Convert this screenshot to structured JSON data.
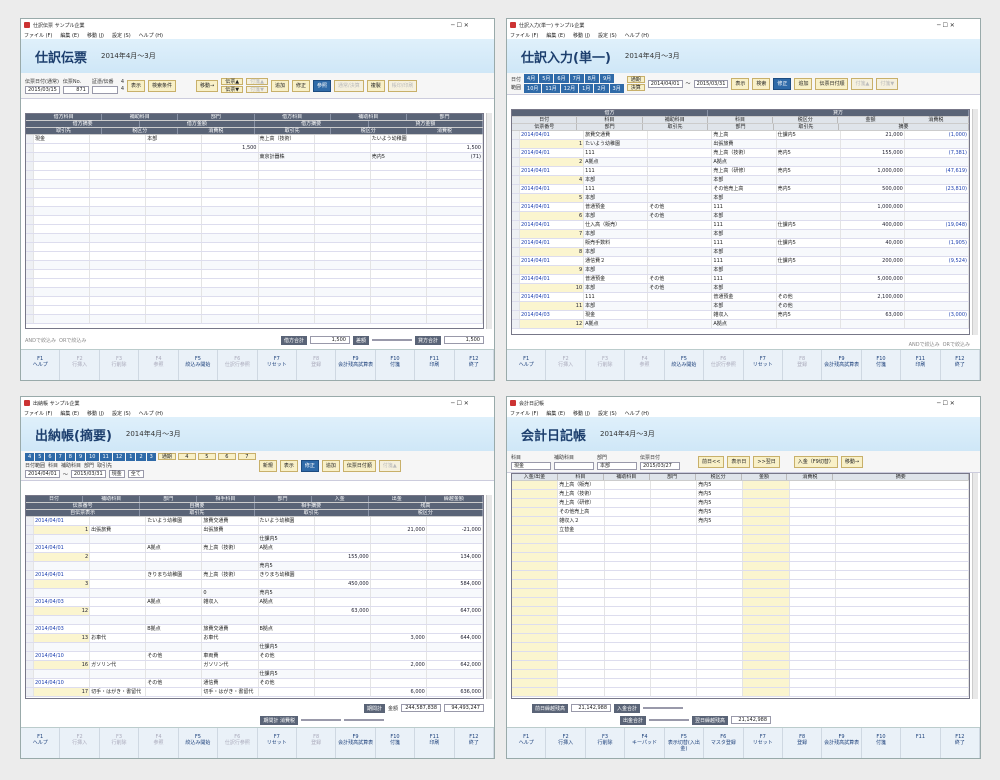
{
  "w1": {
    "title": "仕訳伝票 サンプル企業",
    "menu": [
      "ファイル (F)",
      "編集 (E)",
      "移動 (J)",
      "設定 (S)",
      "ヘルプ (H)"
    ],
    "heading": "仕訳伝票",
    "period": "2014年4月～3月",
    "labels": {
      "date": "伝票日付(通常)",
      "no": "伝票No.",
      "proof": "証憑/伝番",
      "disp": "表示",
      "cond": "検索条件",
      "move": "移動→",
      "slip_up": "伝票▲",
      "slip_dn": "伝票▼",
      "line_up": "付箋▲",
      "line_dn": "付箋▼",
      "add": "追加",
      "fix": "修正",
      "ref": "参照",
      "normal": "通常/決算",
      "copy": "複製",
      "print": "帳印/印刷"
    },
    "date_val": "2015/03/15",
    "no_val": "871",
    "cnt": "4",
    "cnt2": "4",
    "head1": [
      "借方科目",
      "補助科目",
      "部門",
      "借方科目",
      "補助科目",
      "部門"
    ],
    "head2": [
      "借方摘要",
      "借方金額",
      "借方摘要",
      "貸方金額"
    ],
    "head3": [
      "取引先",
      "税区分",
      "消費税",
      "取引先",
      "税区分",
      "消費税"
    ],
    "rows": [
      [
        "現金",
        "",
        "本部",
        "",
        "売上高（技術）",
        "",
        "たいよう幼稚園",
        ""
      ],
      [
        "",
        "",
        "",
        "1,500",
        "",
        "",
        "",
        "1,500"
      ],
      [
        "",
        "",
        "",
        "",
        "東京計器株",
        "",
        "売内5",
        "(71)"
      ]
    ],
    "sum": {
      "and": "ANDで絞込み",
      "or": "ORで絞込み",
      "dr": "借方合計",
      "dr_val": "1,500",
      "diff": "差額",
      "cr": "貸方合計",
      "cr_val": "1,500"
    },
    "fkeys": [
      [
        "F1",
        "ヘルプ"
      ],
      [
        "F2",
        "行挿入"
      ],
      [
        "F3",
        "行削除"
      ],
      [
        "F4",
        "参照"
      ],
      [
        "F5",
        "絞込み開始"
      ],
      [
        "F6",
        "仕訳行参照"
      ],
      [
        "F7",
        "リセット"
      ],
      [
        "F8",
        "登録"
      ],
      [
        "F9",
        "会計残高試算表"
      ],
      [
        "F10",
        "付箋"
      ],
      [
        "F11",
        "印刷"
      ],
      [
        "F12",
        "終了"
      ]
    ]
  },
  "w2": {
    "title": "仕訳入力(単一) サンプル企業",
    "heading": "仕訳入力(単一)",
    "period": "2014年4月～3月",
    "months": [
      "4月",
      "5月",
      "6月",
      "7月",
      "8月",
      "9月",
      "10月",
      "11月",
      "12月",
      "1月",
      "2月",
      "3月"
    ],
    "m_extra": [
      "通期",
      "決算"
    ],
    "range_lbl": "日付",
    "range_lbl2": "範囲",
    "from": "2014/04/01",
    "to": "2015/03/31",
    "btns": [
      "表示",
      "検索",
      "修正",
      "追加",
      "伝票日付順"
    ],
    "tag_up": "付箋▲",
    "tag_dn": "付箋▼",
    "headA": [
      "借方",
      "",
      "",
      "貸方",
      "",
      ""
    ],
    "headB": [
      "日付",
      "科目",
      "補助科目",
      "科目",
      "税区分",
      "金額",
      "消費税"
    ],
    "headC": [
      "伝票番号",
      "証憑/伝番",
      "部門",
      "取引先",
      "部門",
      "取引先",
      "摘要"
    ],
    "rows": [
      [
        "2014/04/01",
        "旅費交通費",
        "",
        "売上高",
        "仕課内5",
        "21,000",
        "(1,000)"
      ],
      [
        "1",
        "たいよう幼稚園",
        "",
        "出張旅費",
        "",
        "",
        ""
      ],
      [
        "2014/04/01",
        "111",
        "",
        "売上高（技術）",
        "売内5",
        "155,000",
        "(7,381)"
      ],
      [
        "2",
        "A拠点",
        "",
        "A拠点",
        "",
        "",
        ""
      ],
      [
        "2014/04/01",
        "111",
        "",
        "売上高（研修）",
        "売内5",
        "1,000,000",
        "(47,619)"
      ],
      [
        "4",
        "本部",
        "",
        "本部",
        "",
        "",
        ""
      ],
      [
        "2014/04/01",
        "111",
        "",
        "その他売上高",
        "売内5",
        "500,000",
        "(23,810)"
      ],
      [
        "5",
        "本部",
        "",
        "本部",
        "",
        "",
        ""
      ],
      [
        "2014/04/01",
        "普通預金",
        "その他",
        "111",
        "",
        "1,000,000",
        ""
      ],
      [
        "6",
        "本部",
        "その他",
        "本部",
        "",
        "",
        ""
      ],
      [
        "2014/04/01",
        "仕入高（販売）",
        "",
        "111",
        "仕課内5",
        "400,000",
        "(19,048)"
      ],
      [
        "7",
        "本部",
        "",
        "本部",
        "",
        "",
        ""
      ],
      [
        "2014/04/01",
        "販売手数料",
        "",
        "111",
        "仕課内5",
        "40,000",
        "(1,905)"
      ],
      [
        "8",
        "本部",
        "",
        "本部",
        "",
        "",
        ""
      ],
      [
        "2014/04/01",
        "通信費２",
        "",
        "111",
        "仕課内5",
        "200,000",
        "(9,524)"
      ],
      [
        "9",
        "本部",
        "",
        "本部",
        "",
        "",
        ""
      ],
      [
        "2014/04/01",
        "普通預金",
        "その他",
        "111",
        "",
        "5,000,000",
        ""
      ],
      [
        "10",
        "本部",
        "その他",
        "本部",
        "",
        "",
        ""
      ],
      [
        "2014/04/01",
        "111",
        "",
        "普通預金",
        "その他",
        "2,100,000",
        ""
      ],
      [
        "11",
        "本部",
        "",
        "本部",
        "その他",
        "",
        ""
      ],
      [
        "2014/04/03",
        "現金",
        "",
        "雑収入",
        "売内5",
        "63,000",
        "(3,000)"
      ],
      [
        "12",
        "A拠点",
        "",
        "A拠点",
        "",
        "",
        ""
      ]
    ],
    "and": "ANDで絞込み",
    "or": "ORで絞込み",
    "fkeys": [
      [
        "F1",
        "ヘルプ"
      ],
      [
        "F2",
        "行挿入"
      ],
      [
        "F3",
        "行削除"
      ],
      [
        "F4",
        "参照"
      ],
      [
        "F5",
        "絞込み開始"
      ],
      [
        "F6",
        "仕訳行参照"
      ],
      [
        "F7",
        "リセット"
      ],
      [
        "F8",
        "登録"
      ],
      [
        "F9",
        "会計残高試算表"
      ],
      [
        "F10",
        "付箋"
      ],
      [
        "F11",
        "印刷"
      ],
      [
        "F12",
        "終了"
      ]
    ]
  },
  "w3": {
    "title": "出納帳 サンプル企業",
    "heading": "出納帳(摘要)",
    "period": "2014年4月～3月",
    "months": [
      "4",
      "5",
      "6",
      "7",
      "8",
      "9",
      "10",
      "11",
      "12",
      "1",
      "2",
      "3"
    ],
    "m_extra": [
      "通期",
      "4",
      "5",
      "6",
      "7"
    ],
    "range": "日付範囲",
    "from": "2014/04/01",
    "to": "2015/03/31",
    "acct": "現金",
    "sub_lbl": "科目",
    "sub2": "補助科目",
    "dept": "部門",
    "all": "全て",
    "partner": "取引先",
    "btns": [
      "新規",
      "表示",
      "修正",
      "追加",
      "伝票日付順"
    ],
    "tag_up": "付箋▲",
    "tag_dn": "付箋▼",
    "headA": [
      "日付",
      "補助科目",
      "部門",
      "相手科目",
      "部門",
      "入金",
      "出金",
      "繰越金額"
    ],
    "headB": [
      "伝票番号",
      "自摘要",
      "相手摘要",
      "残高"
    ],
    "headC": [
      "自伝票表示",
      "取引先",
      "取引先",
      "税区分"
    ],
    "rows": [
      [
        "2014/04/01",
        "",
        "たいよう幼稚園",
        "旅費交通費",
        "たいよう幼稚園",
        "",
        "",
        ""
      ],
      [
        "1",
        "出張旅費",
        "",
        "出張旅費",
        "",
        "",
        "21,000",
        "-21,000"
      ],
      [
        "",
        "",
        "",
        "",
        "仕課内5",
        "",
        "",
        ""
      ],
      [
        "2014/04/01",
        "",
        "A拠点",
        "売上高（技術）",
        "A拠点",
        "",
        "",
        ""
      ],
      [
        "2",
        "",
        "",
        "",
        "",
        "155,000",
        "",
        "134,000"
      ],
      [
        "",
        "",
        "",
        "",
        "売内5",
        "",
        "",
        ""
      ],
      [
        "2014/04/01",
        "",
        "きりまち幼稚園",
        "売上高（技術）",
        "きりまち幼稚園",
        "",
        "",
        ""
      ],
      [
        "3",
        "",
        "",
        "",
        "",
        "450,000",
        "",
        "584,000"
      ],
      [
        "",
        "",
        "",
        "0",
        "売内5",
        "",
        "",
        ""
      ],
      [
        "2014/04/03",
        "",
        "A拠点",
        "雑収入",
        "A拠点",
        "",
        "",
        ""
      ],
      [
        "12",
        "",
        "",
        "",
        "",
        "63,000",
        "",
        "647,000"
      ],
      [
        "",
        "",
        "",
        "",
        "",
        "",
        "",
        ""
      ],
      [
        "2014/04/03",
        "",
        "B拠点",
        "旅費交通費",
        "B拠点",
        "",
        "",
        ""
      ],
      [
        "13",
        "お車代",
        "",
        "お車代",
        "",
        "",
        "3,000",
        "644,000"
      ],
      [
        "",
        "",
        "",
        "",
        "仕課内5",
        "",
        "",
        ""
      ],
      [
        "2014/04/10",
        "",
        "その他",
        "車両費",
        "その他",
        "",
        "",
        ""
      ],
      [
        "16",
        "ガソリン代",
        "",
        "ガソリン代",
        "",
        "",
        "2,000",
        "642,000"
      ],
      [
        "",
        "",
        "",
        "",
        "仕課内5",
        "",
        "",
        ""
      ],
      [
        "2014/04/10",
        "",
        "その他",
        "通信費",
        "その他",
        "",
        "",
        ""
      ],
      [
        "17",
        "切手・はがき・書留代",
        "",
        "切手・はがき・書留代",
        "",
        "",
        "6,000",
        "636,000"
      ]
    ],
    "sum": {
      "period": "期間計",
      "total": "金額",
      "in": "244,587,838",
      "out": "94,493,247",
      "tax": "期間計 消費税"
    },
    "fkeys": [
      [
        "F1",
        "ヘルプ"
      ],
      [
        "F2",
        "行挿入"
      ],
      [
        "F3",
        "行削除"
      ],
      [
        "F4",
        "参照"
      ],
      [
        "F5",
        "絞込み開始"
      ],
      [
        "F6",
        "仕訳行参照"
      ],
      [
        "F7",
        "リセット"
      ],
      [
        "F8",
        "登録"
      ],
      [
        "F9",
        "会計残高試算表"
      ],
      [
        "F10",
        "付箋"
      ],
      [
        "F11",
        "印刷"
      ],
      [
        "F12",
        "終了"
      ]
    ]
  },
  "w4": {
    "title": "会計日記帳",
    "heading": "会計日記帳",
    "period": "2014年4月～3月",
    "lbl": [
      "科目",
      "補助科目",
      "部門",
      "伝票日付"
    ],
    "acct": "現金",
    "dept": "本部",
    "date": "2015/03/27",
    "btns": [
      "前日<<",
      "表示日",
      ">>翌日",
      "入金（F9切替）",
      "移動→"
    ],
    "head": [
      "入金/出金",
      "科目",
      "補助科目",
      "部門",
      "税区分",
      "金額",
      "消費税",
      "摘要"
    ],
    "rows": [
      [
        "",
        "売上高（販売）",
        "",
        "",
        "売内5",
        "",
        "",
        ""
      ],
      [
        "",
        "売上高（技術）",
        "",
        "",
        "売内5",
        "",
        "",
        ""
      ],
      [
        "",
        "売上高（研修）",
        "",
        "",
        "売内5",
        "",
        "",
        ""
      ],
      [
        "",
        "その他売上高",
        "",
        "",
        "売内5",
        "",
        "",
        ""
      ],
      [
        "",
        "雑収入２",
        "",
        "",
        "売内5",
        "",
        "",
        ""
      ],
      [
        "",
        "立替金",
        "",
        "",
        "",
        "",
        "",
        ""
      ]
    ],
    "sum": {
      "prev": "前日繰越残高",
      "prev_val": "21,142,988",
      "in": "入金合計",
      "out": "出金合計",
      "next": "翌日繰越残高",
      "next_val": "21,142,988"
    },
    "fkeys": [
      [
        "F1",
        "ヘルプ"
      ],
      [
        "F2",
        "行挿入"
      ],
      [
        "F3",
        "行削除"
      ],
      [
        "F4",
        "キーパッド"
      ],
      [
        "F5",
        "表示切替(入出金)"
      ],
      [
        "F6",
        "マスタ登録"
      ],
      [
        "F7",
        "リセット"
      ],
      [
        "F8",
        "登録"
      ],
      [
        "F9",
        "会計残高試算表"
      ],
      [
        "F10",
        "付箋"
      ],
      [
        "F11",
        ""
      ],
      [
        "F12",
        "終了"
      ]
    ]
  }
}
